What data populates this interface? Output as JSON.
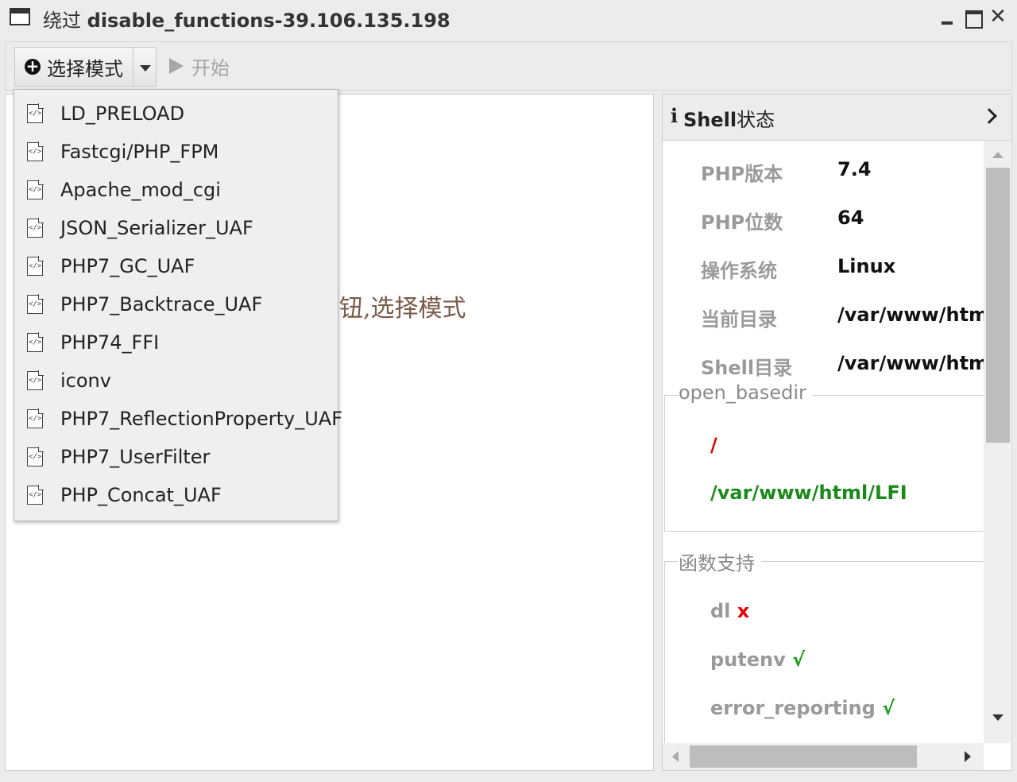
{
  "window": {
    "title_prefix": "绕过",
    "title_main": "disable_functions-39.106.135.198"
  },
  "toolbar": {
    "mode_label": "选择模式",
    "start_label": "开始"
  },
  "main": {
    "hint": "钮,选择模式"
  },
  "menu": {
    "items": [
      {
        "label": "LD_PRELOAD",
        "icon": "php-file-icon"
      },
      {
        "label": "Fastcgi/PHP_FPM",
        "icon": "php-file-icon"
      },
      {
        "label": "Apache_mod_cgi",
        "icon": "php-file-icon"
      },
      {
        "label": "JSON_Serializer_UAF",
        "icon": "php-file-icon"
      },
      {
        "label": "PHP7_GC_UAF",
        "icon": "php-file-icon"
      },
      {
        "label": "PHP7_Backtrace_UAF",
        "icon": "php-file-icon"
      },
      {
        "label": "PHP74_FFI",
        "icon": "php-file-icon"
      },
      {
        "label": "iconv",
        "icon": "php-file-icon"
      },
      {
        "label": "PHP7_ReflectionProperty_UAF",
        "icon": "php-file-icon"
      },
      {
        "label": "PHP7_UserFilter",
        "icon": "php-file-icon"
      },
      {
        "label": "PHP_Concat_UAF",
        "icon": "php-file-icon"
      }
    ]
  },
  "side": {
    "title_bold": "Shell",
    "title_rest": "状态",
    "info": [
      {
        "key": "PHP版本",
        "value": "7.4"
      },
      {
        "key": "PHP位数",
        "value": "64"
      },
      {
        "key": "操作系统",
        "value": "Linux"
      },
      {
        "key": "当前目录",
        "value": "/var/www/htm"
      },
      {
        "key": "Shell目录",
        "value": "/var/www/htm"
      }
    ],
    "open_basedir": {
      "legend": "open_basedir",
      "paths": [
        {
          "text": "/",
          "color": "#e00000"
        },
        {
          "text": "/var/www/html/LFI",
          "color": "#1a8a1a"
        }
      ]
    },
    "functions": {
      "legend": "函数支持",
      "items": [
        {
          "name": "dl",
          "mark": "x",
          "ok": false
        },
        {
          "name": "putenv",
          "mark": "√",
          "ok": true
        },
        {
          "name": "error_reporting",
          "mark": "√",
          "ok": true
        }
      ]
    }
  }
}
